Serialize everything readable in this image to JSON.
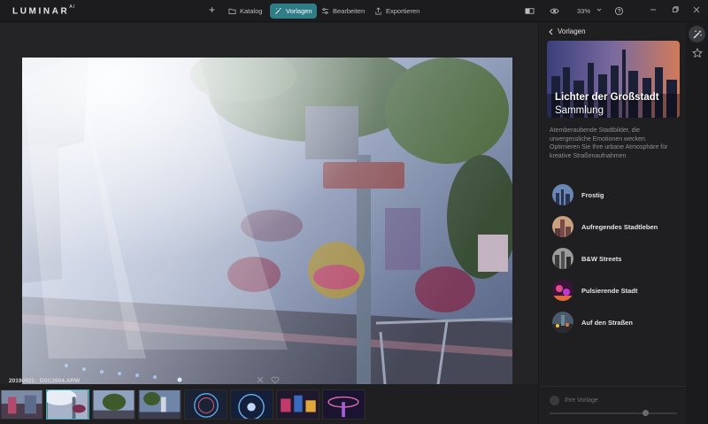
{
  "app": {
    "logo_text": "LUMINAR",
    "logo_super": "AI"
  },
  "toolbar": {
    "add_label": "+",
    "tabs": [
      {
        "label": "Katalog",
        "icon": "folder-icon",
        "active": false
      },
      {
        "label": "Vorlagen",
        "icon": "magic-wand-icon",
        "active": true
      },
      {
        "label": "Bearbeiten",
        "icon": "sliders-icon",
        "active": false
      },
      {
        "label": "Exportieren",
        "icon": "share-icon",
        "active": false
      }
    ],
    "zoom_value": "33%",
    "colors": {
      "active_tab": "#2f7d86",
      "bar": "#1c1c1e"
    }
  },
  "photo": {
    "filename": "20190921-_DSC2004.ARW"
  },
  "filmstrip": {
    "thumb_count": 8,
    "selected_index": 1
  },
  "panel": {
    "back_label": "Vorlagen",
    "collection": {
      "title": "Lichter der Großstadt",
      "subtitle": "Sammlung"
    },
    "description": "Atemberaubende Stadtbilder, die unvergessliche Emotionen wecken. Optimieren Sie Ihre urbane Atmosphäre für kreative Straßenaufnahmen",
    "presets": [
      {
        "label": "Frostig"
      },
      {
        "label": "Aufregendes Stadtleben"
      },
      {
        "label": "B&W Streets"
      },
      {
        "label": "Pulsierende Stadt"
      },
      {
        "label": "Auf den Straßen"
      }
    ],
    "your_preset_label": "Ihre Vorlage",
    "slider_level": 0.75
  }
}
